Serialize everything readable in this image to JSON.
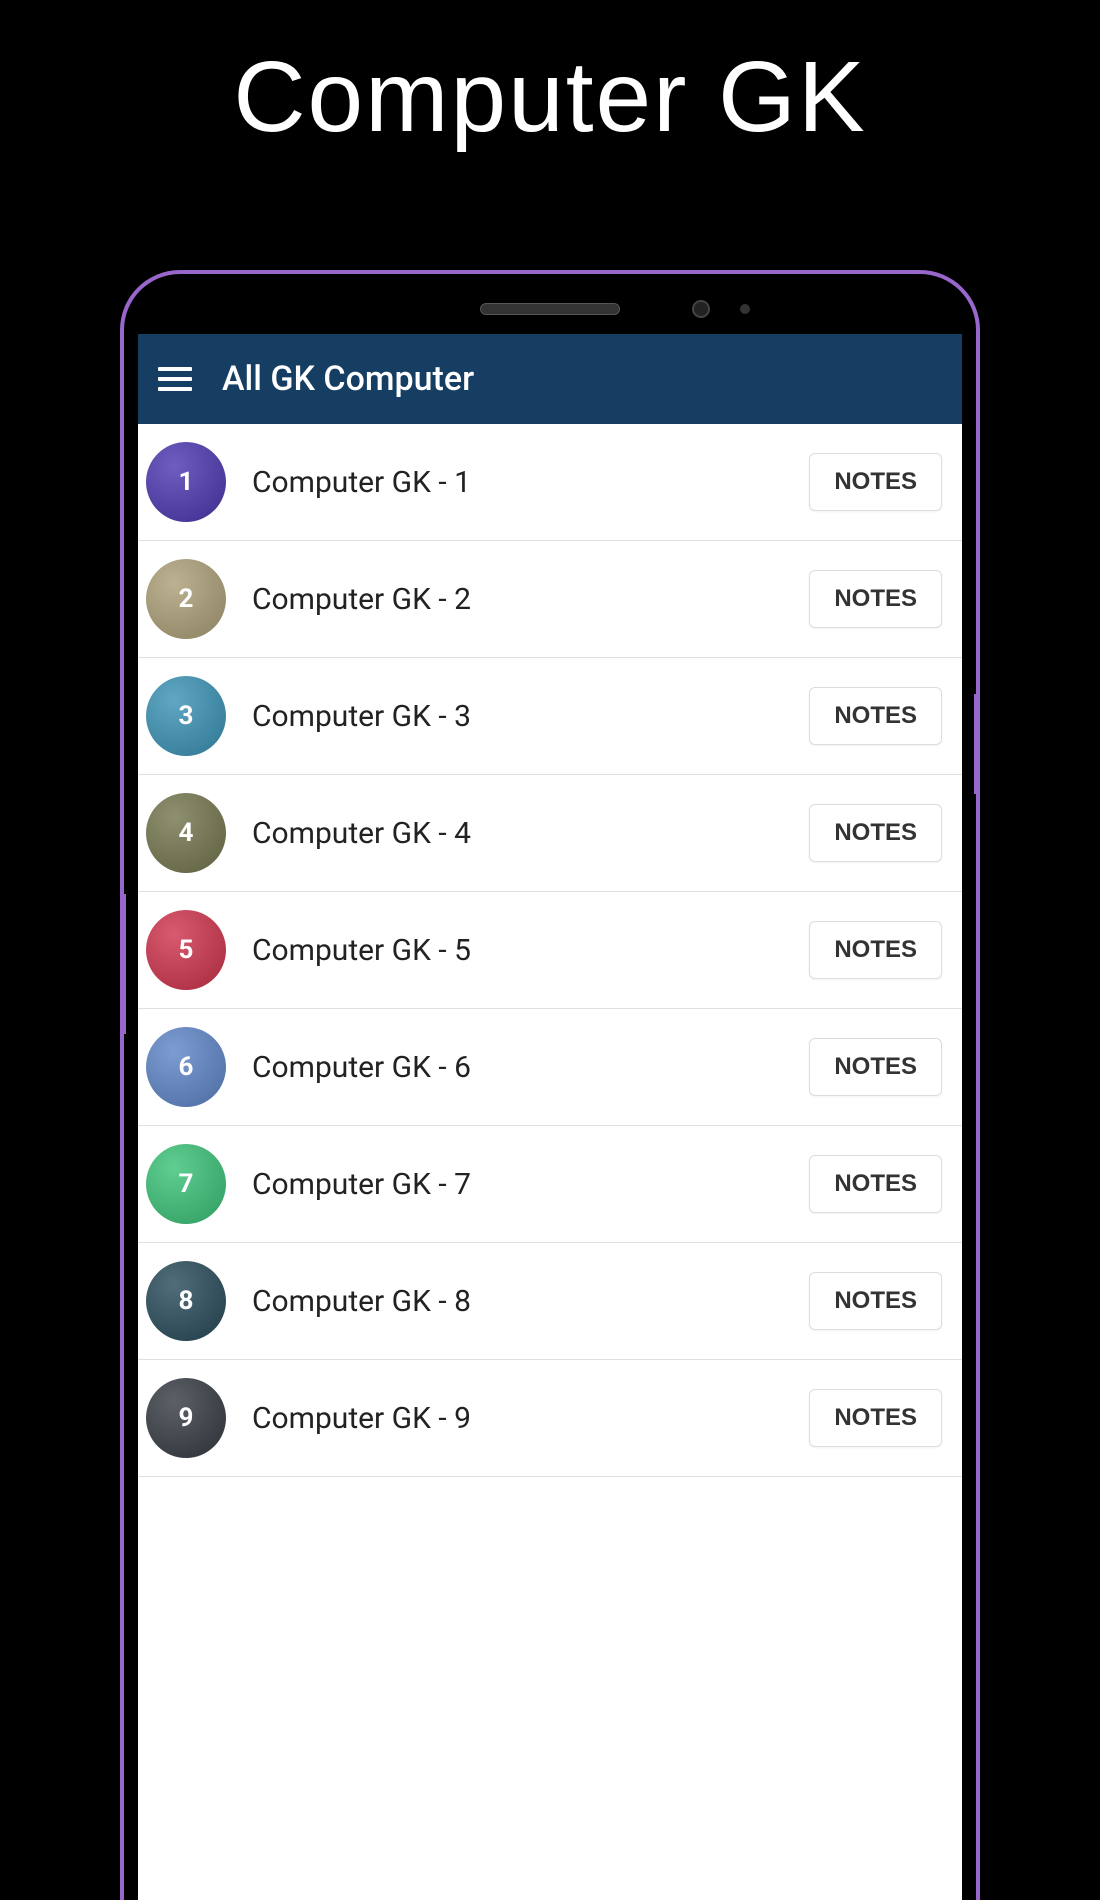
{
  "promo": {
    "title": "Computer GK"
  },
  "header": {
    "title": "All GK Computer"
  },
  "list": {
    "notes_label": "NOTES",
    "items": [
      {
        "number": "1",
        "label": "Computer GK - 1",
        "color": "#3d2c8d"
      },
      {
        "number": "2",
        "label": "Computer GK - 2",
        "color": "#8a8060"
      },
      {
        "number": "3",
        "label": "Computer GK - 3",
        "color": "#2d7591"
      },
      {
        "number": "4",
        "label": "Computer GK - 4",
        "color": "#5c5e3e"
      },
      {
        "number": "5",
        "label": "Computer GK - 5",
        "color": "#a6283c"
      },
      {
        "number": "6",
        "label": "Computer GK - 6",
        "color": "#4a6aa0"
      },
      {
        "number": "7",
        "label": "Computer GK - 7",
        "color": "#2e9b5f"
      },
      {
        "number": "8",
        "label": "Computer GK - 8",
        "color": "#1f3b47"
      },
      {
        "number": "9",
        "label": "Computer GK - 9",
        "color": "#2a2f35"
      }
    ]
  }
}
